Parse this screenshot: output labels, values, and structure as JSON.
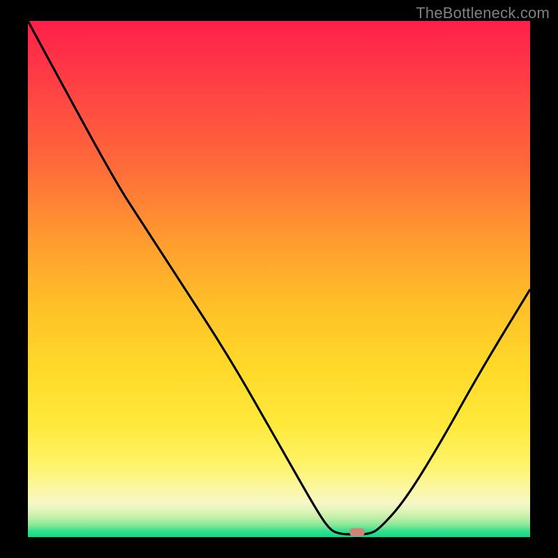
{
  "watermark": "TheBottleneck.com",
  "marker": {
    "x_pct": 65.5,
    "y_pct": 99.1
  },
  "chart_data": {
    "type": "line",
    "title": "",
    "xlabel": "",
    "ylabel": "",
    "xlim": [
      0,
      100
    ],
    "ylim": [
      0,
      100
    ],
    "curve": [
      {
        "x": 0,
        "y": 100
      },
      {
        "x": 10,
        "y": 82
      },
      {
        "x": 18,
        "y": 68
      },
      {
        "x": 22,
        "y": 62
      },
      {
        "x": 30,
        "y": 50
      },
      {
        "x": 40,
        "y": 35
      },
      {
        "x": 50,
        "y": 18
      },
      {
        "x": 57,
        "y": 6
      },
      {
        "x": 60,
        "y": 1.5
      },
      {
        "x": 62,
        "y": 0.6
      },
      {
        "x": 65,
        "y": 0.5
      },
      {
        "x": 68,
        "y": 0.6
      },
      {
        "x": 70,
        "y": 1.6
      },
      {
        "x": 75,
        "y": 7
      },
      {
        "x": 82,
        "y": 18
      },
      {
        "x": 90,
        "y": 32
      },
      {
        "x": 100,
        "y": 48
      }
    ],
    "marker": {
      "x": 65.5,
      "y": 0.9,
      "color": "#cf8379"
    },
    "background_gradient": {
      "direction": "top-to-bottom",
      "stops": [
        {
          "pct": 0,
          "color": "#ff1f4a"
        },
        {
          "pct": 50,
          "color": "#ffbf28"
        },
        {
          "pct": 85,
          "color": "#fff36a"
        },
        {
          "pct": 100,
          "color": "#12d988"
        }
      ]
    }
  }
}
